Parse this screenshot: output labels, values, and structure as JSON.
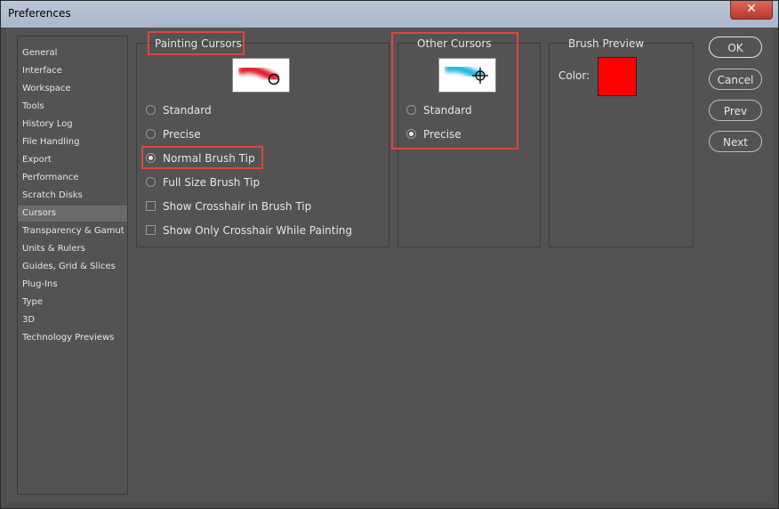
{
  "window": {
    "title": "Preferences",
    "close_glyph": "✕"
  },
  "sidebar": {
    "items": [
      {
        "label": "General"
      },
      {
        "label": "Interface"
      },
      {
        "label": "Workspace"
      },
      {
        "label": "Tools"
      },
      {
        "label": "History Log"
      },
      {
        "label": "File Handling"
      },
      {
        "label": "Export"
      },
      {
        "label": "Performance"
      },
      {
        "label": "Scratch Disks"
      },
      {
        "label": "Cursors"
      },
      {
        "label": "Transparency & Gamut"
      },
      {
        "label": "Units & Rulers"
      },
      {
        "label": "Guides, Grid & Slices"
      },
      {
        "label": "Plug-Ins"
      },
      {
        "label": "Type"
      },
      {
        "label": "3D"
      },
      {
        "label": "Technology Previews"
      }
    ],
    "selected": "Cursors"
  },
  "painting_cursors": {
    "label": "Painting Cursors",
    "options": [
      {
        "label": "Standard",
        "checked": false
      },
      {
        "label": "Precise",
        "checked": false
      },
      {
        "label": "Normal Brush Tip",
        "checked": true
      },
      {
        "label": "Full Size Brush Tip",
        "checked": false
      }
    ],
    "checkboxes": [
      {
        "label": "Show Crosshair in Brush Tip",
        "checked": false
      },
      {
        "label": "Show Only Crosshair While Painting",
        "checked": false
      }
    ],
    "preview_icon": "red-brush-stroke-with-circle-cursor"
  },
  "other_cursors": {
    "label": "Other Cursors",
    "options": [
      {
        "label": "Standard",
        "checked": false
      },
      {
        "label": "Precise",
        "checked": true
      }
    ],
    "preview_icon": "cyan-brush-stroke-with-crosshair-cursor"
  },
  "brush_preview": {
    "label": "Brush Preview",
    "color_label": "Color:",
    "color": "#ff0000"
  },
  "buttons": {
    "ok": "OK",
    "cancel": "Cancel",
    "prev": "Prev",
    "next": "Next"
  },
  "colors": {
    "highlight": "#e0463c",
    "panel_bg": "#535353"
  }
}
